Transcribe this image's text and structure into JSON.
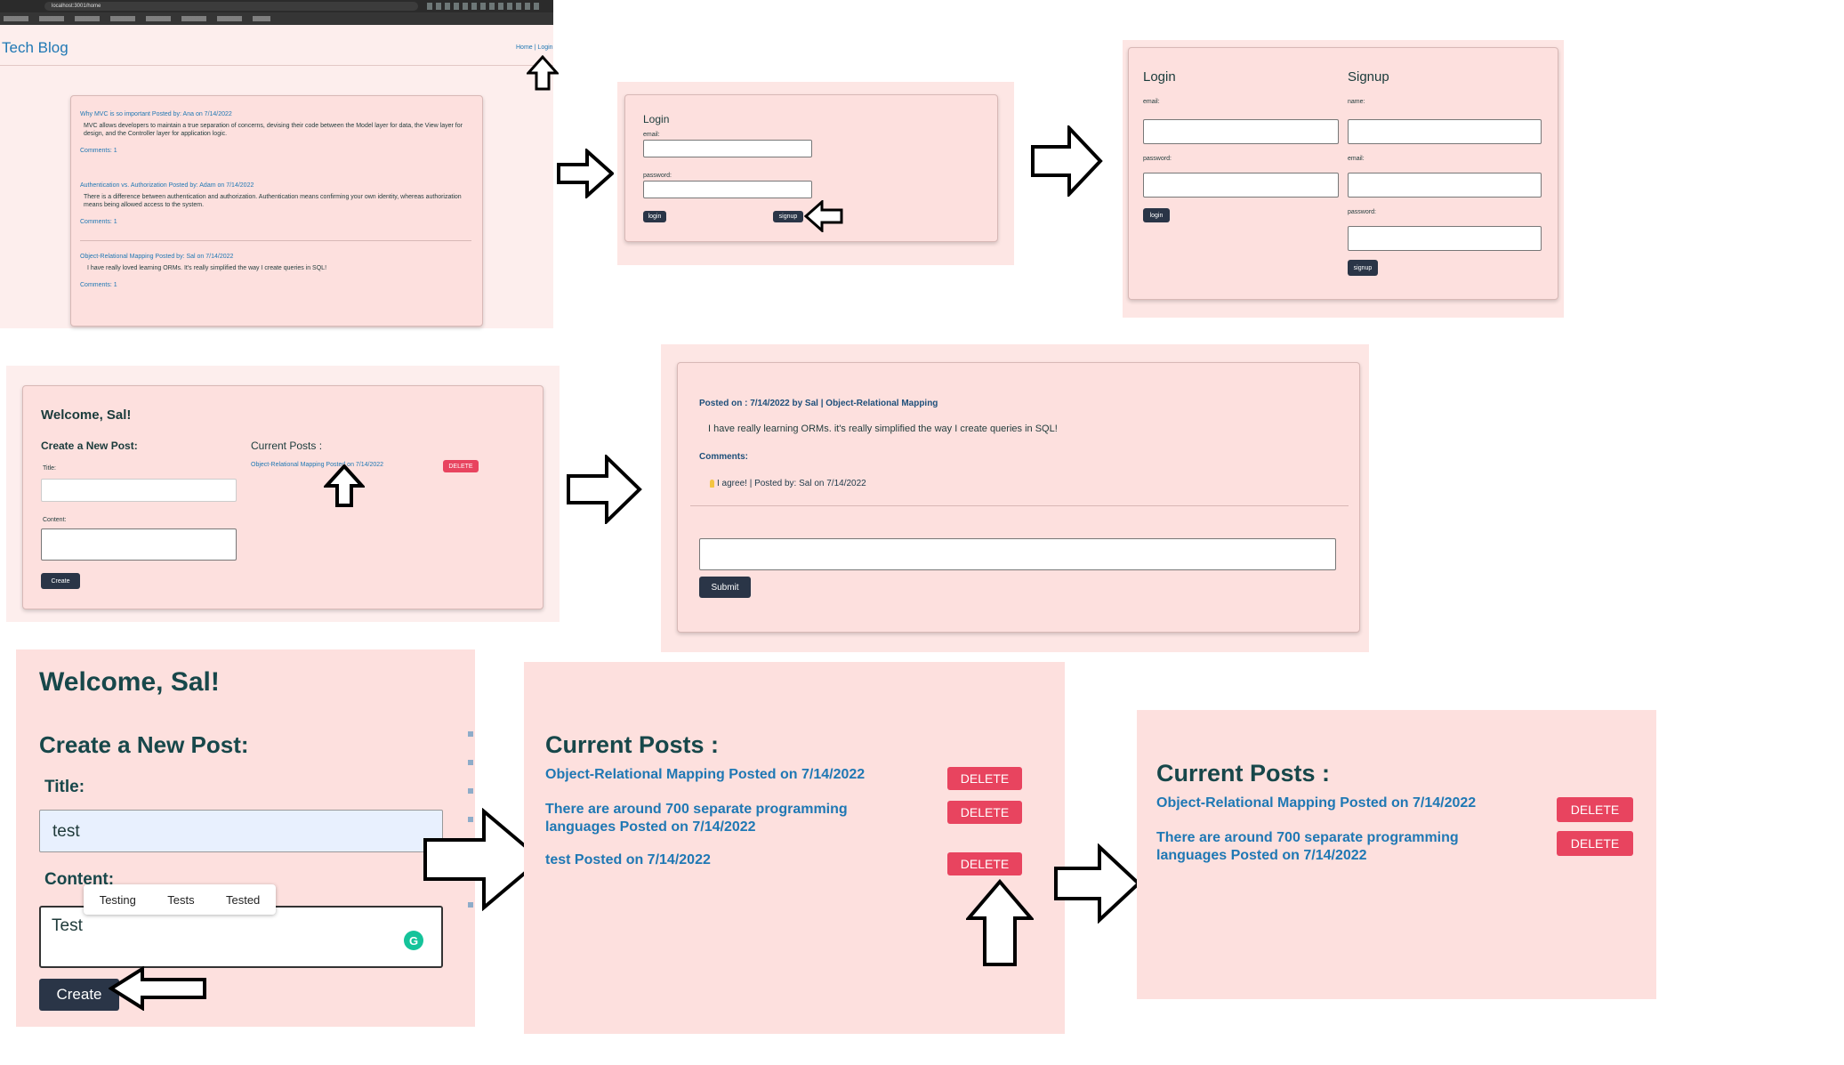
{
  "browser": {
    "url": "localhost:3001/home"
  },
  "panel1": {
    "brand": "Tech Blog",
    "nav_home": "Home",
    "nav_login": "Login",
    "posts": [
      {
        "title": "Why MVC is so important Posted by: Ana on 7/14/2022",
        "body": "MVC allows developers to maintain a true separation of concerns, devising their code between the Model layer for data, the View layer for design, and the Controller layer for application logic.",
        "comments": "Comments: 1"
      },
      {
        "title": "Authentication vs. Authorization Posted by: Adam on 7/14/2022",
        "body": "There is a difference between authentication and authorization. Authentication means confirming your own identity, whereas authorization means being allowed access to the system.",
        "comments": "Comments: 1"
      },
      {
        "title": "Object-Relational Mapping Posted by: Sal on 7/14/2022",
        "body": "I have really loved learning ORMs. It's really simplified the way I create queries in SQL!",
        "comments": "Comments: 1"
      }
    ]
  },
  "panel2": {
    "title": "Login",
    "email_label": "email:",
    "password_label": "password:",
    "login_button": "login",
    "signup_button": "signup"
  },
  "panel3": {
    "login_title": "Login",
    "signup_title": "Signup",
    "email_label": "email:",
    "password_label": "password:",
    "login_button": "login",
    "name_label": "name:",
    "signup_email_label": "email:",
    "signup_password_label": "password:",
    "signup_button": "signup"
  },
  "panel4": {
    "welcome": "Welcome, Sal!",
    "create_title": "Create a New Post:",
    "title_label": "Title:",
    "content_label": "Content:",
    "create_button": "Create",
    "current_title": "Current Posts :",
    "post_link": "Object-Relational Mapping Posted on 7/14/2022",
    "delete_button": "DELETE"
  },
  "panel5": {
    "meta": "Posted on : 7/14/2022 by Sal | Object-Relational Mapping",
    "body": "I have really learning ORMs. it's really simplified the way I create queries in SQL!",
    "comments_label": "Comments:",
    "comment": "I agree! | Posted by: Sal on 7/14/2022",
    "submit_button": "Submit"
  },
  "panel6": {
    "welcome": "Welcome, Sal!",
    "create_title": "Create a New Post:",
    "title_label": "Title:",
    "title_value": "test",
    "content_label": "Content:",
    "content_value": "Test",
    "suggestions": [
      "Testing",
      "Tests",
      "Tested"
    ],
    "create_button": "Create"
  },
  "panel7": {
    "current_title": "Current Posts :",
    "posts": [
      {
        "link": "Object-Relational Mapping Posted on 7/14/2022",
        "delete": "DELETE"
      },
      {
        "link": "There are around 700 separate programming languages Posted on 7/14/2022",
        "delete": "DELETE"
      },
      {
        "link": "test Posted on 7/14/2022",
        "delete": "DELETE"
      }
    ]
  },
  "panel8": {
    "current_title": "Current Posts :",
    "posts": [
      {
        "link": "Object-Relational Mapping Posted on 7/14/2022",
        "delete": "DELETE"
      },
      {
        "link": "There are around 700 separate programming languages Posted on 7/14/2022",
        "delete": "DELETE"
      }
    ]
  },
  "icons": {
    "grammarly": "grammarly-icon",
    "bulb": "lightbulb-icon",
    "arrow": "outline-arrow-icon"
  },
  "colors": {
    "panel_bg": "#fde0de",
    "link": "#1f78b4",
    "dark_button": "#2a3547",
    "delete_button": "#e8445f"
  }
}
